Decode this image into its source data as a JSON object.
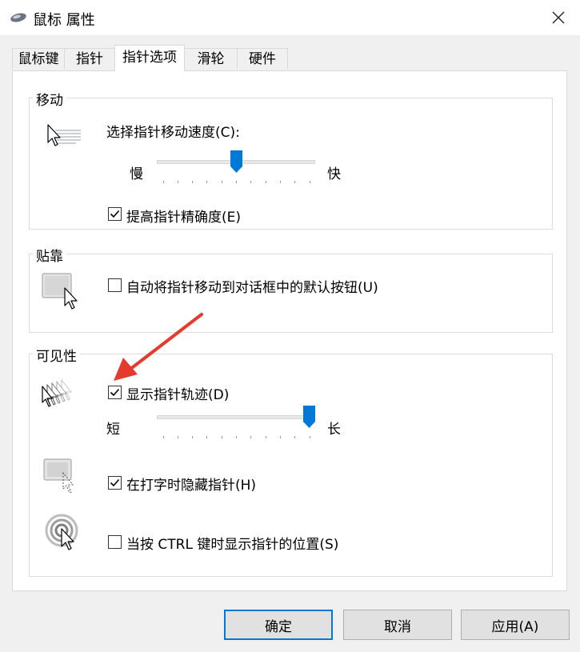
{
  "window": {
    "title": "鼠标 属性"
  },
  "tabs": [
    {
      "label": "鼠标键",
      "active": false
    },
    {
      "label": "指针",
      "active": false
    },
    {
      "label": "指针选项",
      "active": true
    },
    {
      "label": "滑轮",
      "active": false
    },
    {
      "label": "硬件",
      "active": false
    }
  ],
  "motion": {
    "title": "移动",
    "speed_label": "选择指针移动速度(C):",
    "slow_label": "慢",
    "fast_label": "快",
    "speed_level": 0.5,
    "precision_label": "提高指针精确度(E)",
    "precision_checked": true
  },
  "snap": {
    "title": "贴靠",
    "snap_label": "自动将指针移动到对话框中的默认按钮(U)",
    "snap_checked": false
  },
  "visibility": {
    "title": "可见性",
    "trails_label": "显示指针轨迹(D)",
    "trails_checked": true,
    "short_label": "短",
    "long_label": "长",
    "trail_level": 1.0,
    "hide_label": "在打字时隐藏指针(H)",
    "hide_checked": true,
    "ctrl_label": "当按 CTRL 键时显示指针的位置(S)",
    "ctrl_checked": false
  },
  "buttons": {
    "ok": "确定",
    "cancel": "取消",
    "apply": "应用(A)"
  },
  "colors": {
    "accent": "#0078d7",
    "annotation_arrow": "#e53b2c"
  }
}
